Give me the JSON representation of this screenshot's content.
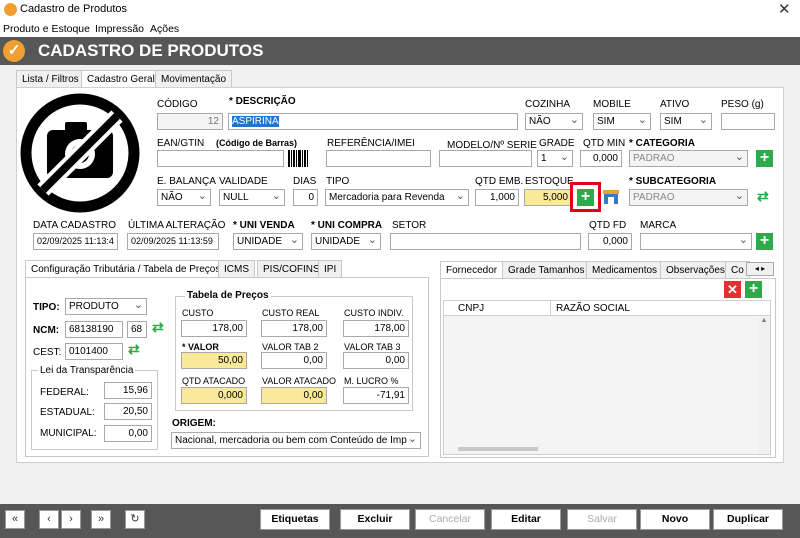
{
  "window": {
    "title": "Cadastro de Produtos",
    "close_glyph": "✕"
  },
  "menu": [
    "Produto e Estoque",
    "Impressão",
    "Ações"
  ],
  "banner": {
    "title": "CADASTRO DE PRODUTOS",
    "check_glyph": "✓"
  },
  "main_tabs": [
    "Lista / Filtros",
    "Cadastro Geral",
    "Movimentação"
  ],
  "form": {
    "codigo": {
      "label": "CÓDIGO",
      "value": "12"
    },
    "descricao": {
      "label": "* DESCRIÇÃO",
      "value": "ASPIRINA"
    },
    "cozinha": {
      "label": "COZINHA",
      "value": "NÃO"
    },
    "mobile": {
      "label": "MOBILE",
      "value": "SIM"
    },
    "ativo": {
      "label": "ATIVO",
      "value": "SIM"
    },
    "peso": {
      "label": "PESO (g)",
      "value": ""
    },
    "ean": {
      "label": "EAN/GTIN",
      "hint": "(Código de Barras)",
      "value": ""
    },
    "referencia": {
      "label": "REFERÊNCIA/IMEI",
      "value": ""
    },
    "modelo": {
      "label": "MODELO/Nº SERIE",
      "value": ""
    },
    "grade": {
      "label": "GRADE",
      "value": "1"
    },
    "qtd_min": {
      "label": "QTD MIN",
      "value": "0,000"
    },
    "categoria": {
      "label": "* CATEGORIA",
      "value": "PADRAO"
    },
    "balanca": {
      "label": "E. BALANÇA",
      "value": "NÃO"
    },
    "validade": {
      "label": "VALIDADE",
      "value": "NULL"
    },
    "dias": {
      "label": "DIAS",
      "value": "0"
    },
    "tipo": {
      "label": "TIPO",
      "value": "Mercadoria para Revenda"
    },
    "qtd_emb": {
      "label": "QTD EMB.",
      "value": "1,000"
    },
    "estoque": {
      "label": "ESTOQUE",
      "value": "5,000"
    },
    "subcategoria": {
      "label": "* SUBCATEGORIA",
      "value": "PADRAO"
    },
    "data_cadastro": {
      "label": "DATA CADASTRO",
      "value": "02/09/2025 11:13:4"
    },
    "ultima_alteracao": {
      "label": "ÚLTIMA ALTERAÇÃO",
      "value": "02/09/2025 11:13:59"
    },
    "uni_venda": {
      "label": "* UNI VENDA",
      "value": "UNIDADE"
    },
    "uni_compra": {
      "label": "* UNI COMPRA",
      "value": "UNIDADE"
    },
    "setor": {
      "label": "SETOR",
      "value": ""
    },
    "qtd_fd": {
      "label": "QTD FD",
      "value": "0,000"
    },
    "marca": {
      "label": "MARCA",
      "value": ""
    }
  },
  "tax_tabs": [
    "Configuração Tributária / Tabela de Preços",
    "ICMS",
    "PIS/COFINS",
    "IPI"
  ],
  "tax": {
    "tipo": {
      "label": "TIPO:",
      "value": "PRODUTO"
    },
    "ncm": {
      "label": "NCM:",
      "value": "68138190",
      "extra": "68"
    },
    "cest": {
      "label": "CEST:",
      "value": "0101400"
    },
    "lei": {
      "title": "Lei da Transparência",
      "federal": {
        "label": "FEDERAL:",
        "value": "15,96"
      },
      "estadual": {
        "label": "ESTADUAL:",
        "value": "20,50"
      },
      "municipal": {
        "label": "MUNICIPAL:",
        "value": "0,00"
      }
    },
    "precos": {
      "title": "Tabela de Preços",
      "custo": {
        "label": "CUSTO",
        "value": "178,00"
      },
      "custo_real": {
        "label": "CUSTO REAL",
        "value": "178,00"
      },
      "custo_indiv": {
        "label": "CUSTO INDIV.",
        "value": "178,00"
      },
      "valor": {
        "label": "* VALOR",
        "value": "50,00"
      },
      "valor_tab2": {
        "label": "VALOR TAB 2",
        "value": "0,00"
      },
      "valor_tab3": {
        "label": "VALOR TAB 3",
        "value": "0,00"
      },
      "qtd_atacado": {
        "label": "QTD ATACADO",
        "value": "0,000"
      },
      "valor_atacado": {
        "label": "VALOR ATACADO",
        "value": "0,00"
      },
      "lucro": {
        "label": "M. LUCRO %",
        "value": "-71,91"
      }
    },
    "origem": {
      "label": "ORIGEM:",
      "value": "Nacional, mercadoria ou bem com Conteúdo de Imp"
    }
  },
  "right_tabs": [
    "Fornecedor",
    "Grade Tamanhos",
    "Medicamentos",
    "Observações",
    "Co"
  ],
  "fornecedor_table": {
    "columns": [
      "CNPJ",
      "RAZÃO SOCIAL"
    ]
  },
  "bottom": {
    "nav": [
      "«",
      "‹",
      "›",
      "»",
      "↻"
    ],
    "actions": [
      "Etiquetas",
      "Excluir",
      "Cancelar",
      "Editar",
      "Salvar",
      "Novo",
      "Duplicar"
    ]
  },
  "colors": {
    "accent": "#f0a030",
    "bar": "#575757",
    "green": "#2eaa4a",
    "red": "#e03030",
    "yellow": "#fbe99a",
    "highlight": "#e0001b"
  }
}
